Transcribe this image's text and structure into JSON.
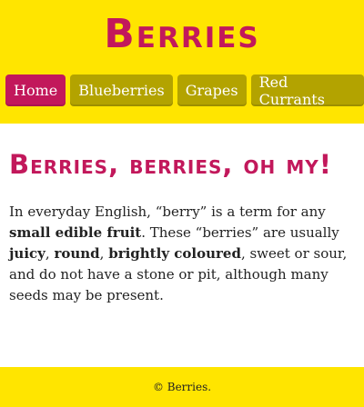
{
  "header": {
    "site_title": "Berries"
  },
  "nav": {
    "items": [
      {
        "label": "Home",
        "active": true
      },
      {
        "label": "Blueberries",
        "active": false
      },
      {
        "label": "Grapes",
        "active": false
      },
      {
        "label": "Red Currants",
        "active": false
      }
    ]
  },
  "main": {
    "heading": "Berries, berries, oh my!",
    "intro": {
      "t1": "In everyday English, “berry” is a term for any ",
      "b1": "small edible fruit",
      "t2": ". These “berries” are usually ",
      "b2": "juicy",
      "t3": ", ",
      "b3": "round",
      "t4": ", ",
      "b4": "brightly coloured",
      "t5": ", sweet or sour, and do not have a stone or pit, although many seeds may be present."
    }
  },
  "footer": {
    "text": "© Berries."
  },
  "colors": {
    "header_bg": "#ffe500",
    "accent": "#c2185b",
    "nav_inactive": "#b3a300"
  }
}
